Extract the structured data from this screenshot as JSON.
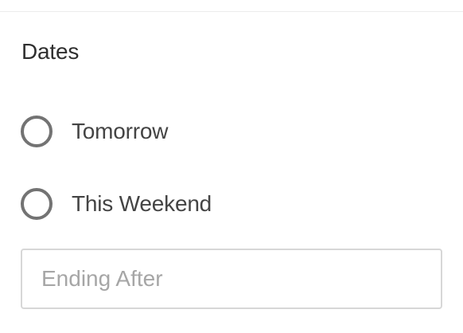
{
  "filter": {
    "title": "Dates",
    "options": [
      {
        "label": "Tomorrow",
        "selected": false
      },
      {
        "label": "This Weekend",
        "selected": false
      }
    ],
    "ending_after": {
      "value": "",
      "placeholder": "Ending After"
    }
  },
  "colors": {
    "radio_border": "#737373",
    "input_border": "#d7d7d7",
    "placeholder": "#a6a6a6",
    "text": "#444444"
  }
}
